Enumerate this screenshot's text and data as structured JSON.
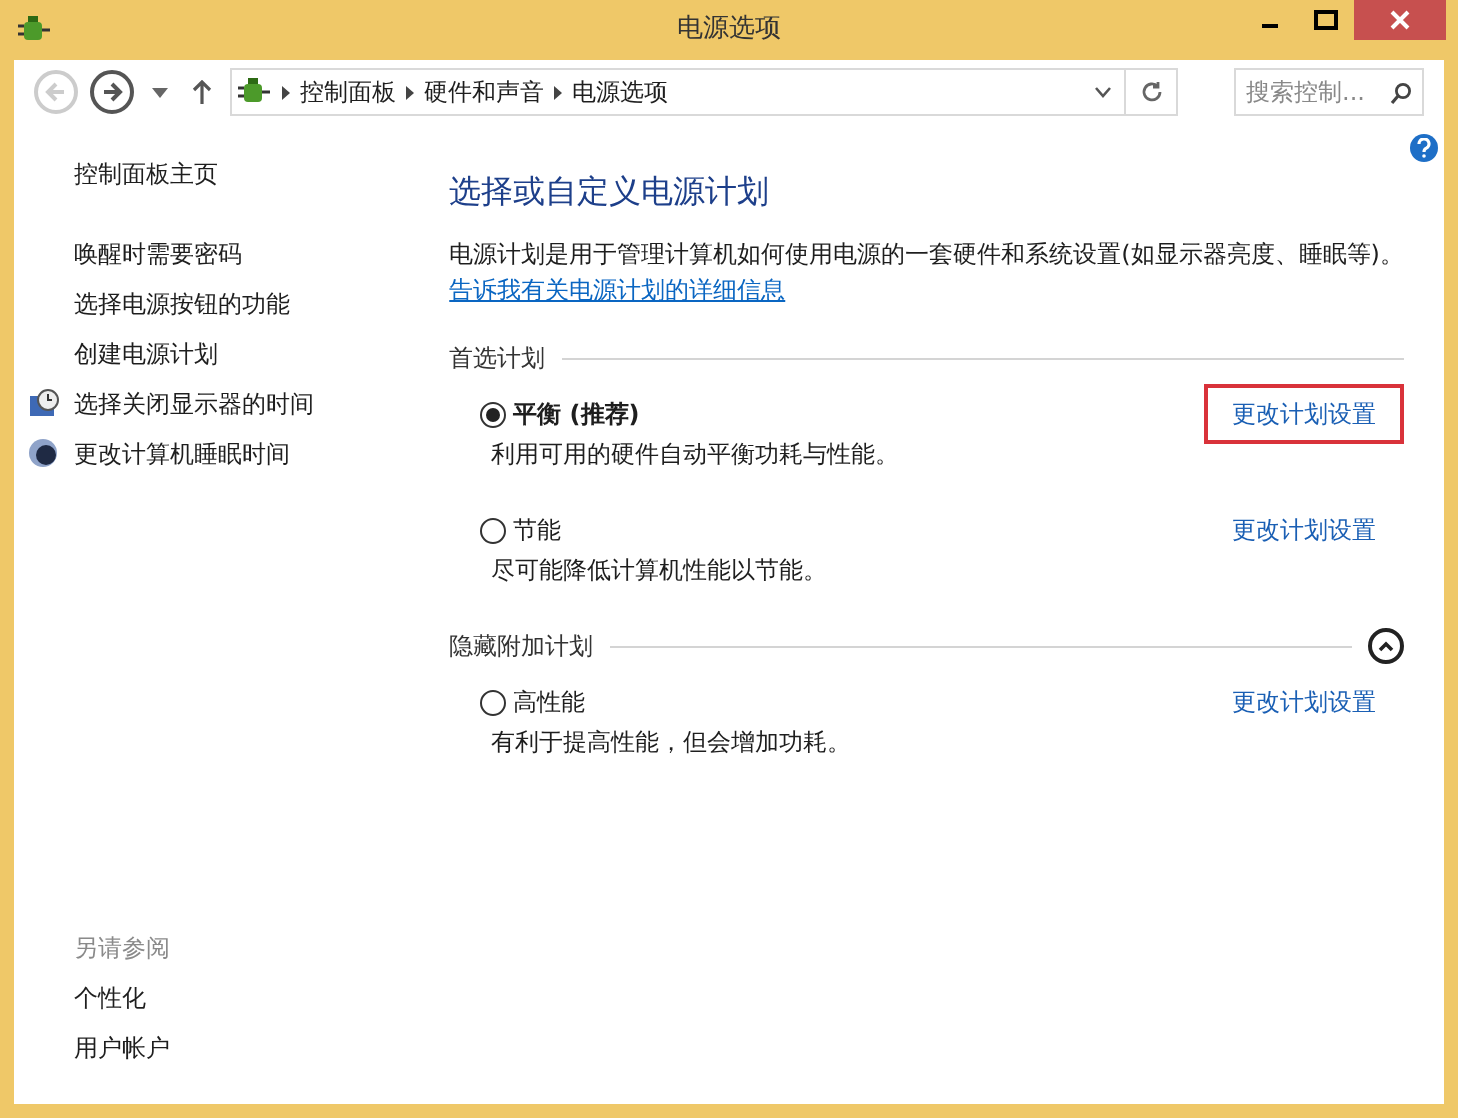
{
  "window": {
    "title": "电源选项"
  },
  "address_bar": {
    "crumbs": [
      "控制面板",
      "硬件和声音",
      "电源选项"
    ]
  },
  "search": {
    "placeholder": "搜索控制..."
  },
  "sidebar": {
    "home": "控制面板主页",
    "items": [
      {
        "label": "唤醒时需要密码",
        "kind": "plain"
      },
      {
        "label": "选择电源按钮的功能",
        "kind": "plain"
      },
      {
        "label": "创建电源计划",
        "kind": "plain"
      },
      {
        "label": "选择关闭显示器的时间",
        "kind": "display"
      },
      {
        "label": "更改计算机睡眠时间",
        "kind": "sleep"
      }
    ],
    "see_also": {
      "heading": "另请参阅",
      "links": [
        "个性化",
        "用户帐户"
      ]
    }
  },
  "main": {
    "title": "选择或自定义电源计划",
    "description": "电源计划是用于管理计算机如何使用电源的一套硬件和系统设置(如显示器亮度、睡眠等)。",
    "learn_more": "告诉我有关电源计划的详细信息",
    "sections": [
      {
        "heading": "首选计划",
        "collapse_button": false,
        "plans": [
          {
            "name": "平衡 (推荐)",
            "description": "利用可用的硬件自动平衡功耗与性能。",
            "selected": true,
            "link": "更改计划设置",
            "highlighted": true
          },
          {
            "name": "节能",
            "description": "尽可能降低计算机性能以节能。",
            "selected": false,
            "link": "更改计划设置",
            "highlighted": false
          }
        ]
      },
      {
        "heading": "隐藏附加计划",
        "collapse_button": true,
        "plans": [
          {
            "name": "高性能",
            "description": "有利于提高性能，但会增加功耗。",
            "selected": false,
            "link": "更改计划设置",
            "highlighted": false
          }
        ]
      }
    ]
  }
}
